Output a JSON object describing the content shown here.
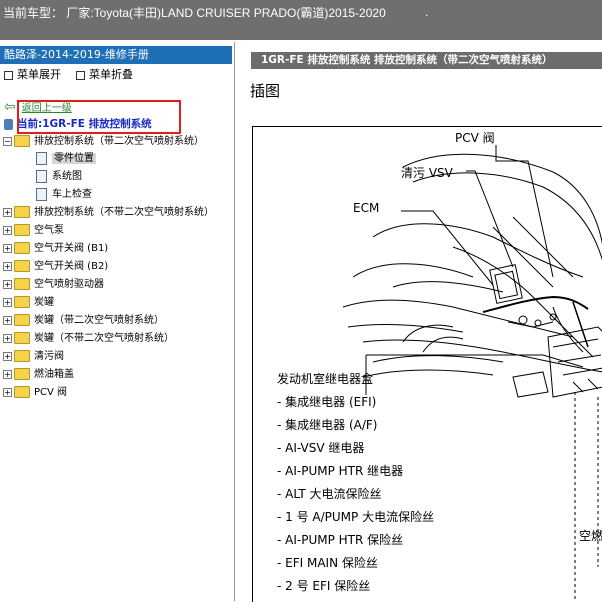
{
  "title_bar": {
    "text": "当前车型：  厂家:Toyota(丰田)LAND CRUISER PRADO(霸道)2015-2020",
    "dot": "."
  },
  "left_panel": {
    "header": "酷路泽-2014-2019-维修手册",
    "expand_label": "菜单展开",
    "collapse_label": "菜单折叠",
    "back_label": "返回上一级",
    "current_label": "当前:1GR-FE 排放控制系统",
    "tree": [
      {
        "label": "排放控制系统（带二次空气喷射系统）",
        "expanded": true
      },
      {
        "label": "零件位置",
        "child": true,
        "selected": true
      },
      {
        "label": "系统图",
        "child": true
      },
      {
        "label": "车上检查",
        "child": true
      },
      {
        "label": "排放控制系统（不带二次空气喷射系统）"
      },
      {
        "label": "空气泵"
      },
      {
        "label": "空气开关阀 (B1)"
      },
      {
        "label": "空气开关阀 (B2)"
      },
      {
        "label": "空气喷射驱动器"
      },
      {
        "label": "炭罐"
      },
      {
        "label": "炭罐（带二次空气喷射系统）"
      },
      {
        "label": "炭罐（不带二次空气喷射系统）"
      },
      {
        "label": "清污阀"
      },
      {
        "label": "燃油箱盖"
      },
      {
        "label": "PCV 阀"
      }
    ]
  },
  "content": {
    "header": "1GR-FE 排放控制系统  排放控制系统（带二次空气喷射系统）",
    "section_title": "插图",
    "figure_labels": {
      "pcv": "PCV 阀",
      "vsv": "清污 VSV",
      "ecm": "ECM",
      "relay_box": "发动机室继电器盒",
      "items": [
        "- 集成继电器 (EFI)",
        "- 集成继电器 (A/F)",
        "- AI-VSV 继电器",
        "- AI-PUMP HTR 继电器",
        "- ALT 大电流保险丝",
        "- 1 号 A/PUMP 大电流保险丝",
        "- AI-PUMP HTR 保险丝",
        "- EFI MAIN 保险丝",
        "- 2 号 EFI 保险丝"
      ],
      "cut_label": "空燃"
    }
  }
}
